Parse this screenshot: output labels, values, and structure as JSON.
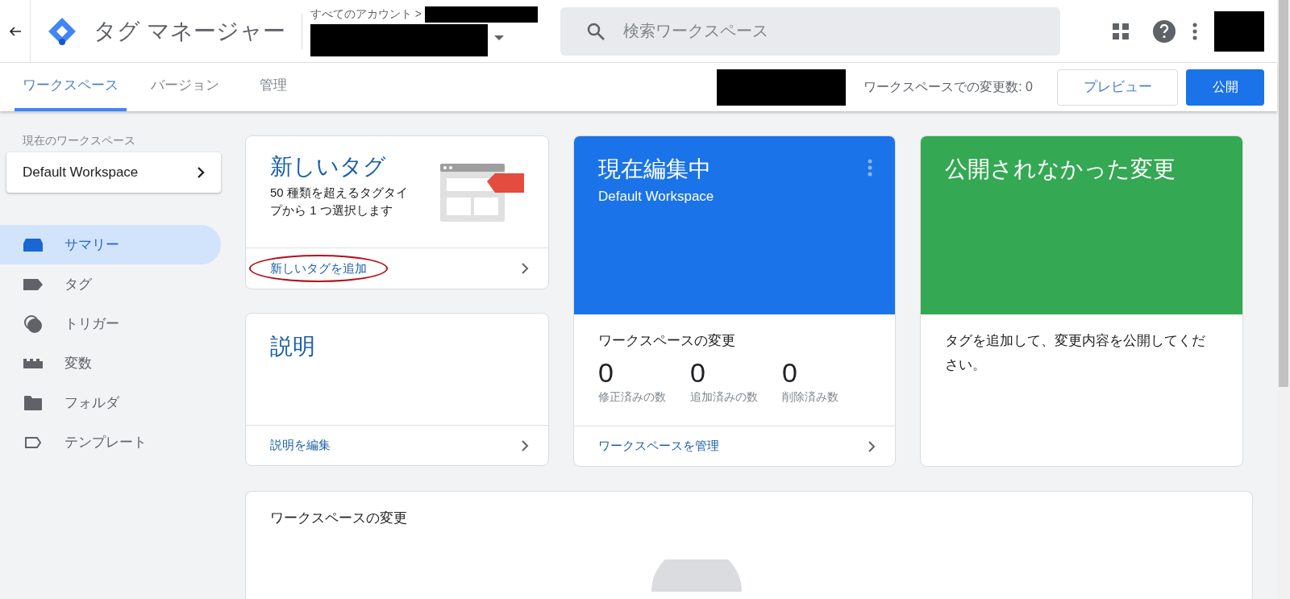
{
  "header": {
    "app_title": "タグ マネージャー",
    "breadcrumb": "すべてのアカウント >",
    "search": {
      "placeholder": "検索ワークスペース"
    }
  },
  "tabs": [
    {
      "label": "ワークスペース",
      "selected": true
    },
    {
      "label": "バージョン",
      "selected": false
    },
    {
      "label": "管理",
      "selected": false
    }
  ],
  "toolbar": {
    "changes_count": "ワークスペースでの変更数: 0",
    "preview_button": "プレビュー",
    "publish_button": "公開"
  },
  "sidebar": {
    "section_label": "現在のワークスペース",
    "workspace": "Default Workspace",
    "items": [
      {
        "label": "サマリー",
        "kind": "summary",
        "selected": true
      },
      {
        "label": "タグ",
        "kind": "tag",
        "selected": false
      },
      {
        "label": "トリガー",
        "kind": "trigger",
        "selected": false
      },
      {
        "label": "変数",
        "kind": "variable",
        "selected": false
      },
      {
        "label": "フォルダ",
        "kind": "folder",
        "selected": false
      },
      {
        "label": "テンプレート",
        "kind": "template",
        "selected": false
      }
    ]
  },
  "new_tag_card": {
    "title": "新しいタグ",
    "description": "50 種類を超えるタグタイプから 1 つ選択します",
    "link": "新しいタグを追加",
    "link_circled": true
  },
  "description_card": {
    "title": "説明",
    "link": "説明を編集"
  },
  "editing_card": {
    "title": "現在編集中",
    "workspace": "Default Workspace",
    "changes_label": "ワークスペースの変更",
    "stats": [
      {
        "value": "0",
        "label": "修正済みの数"
      },
      {
        "value": "0",
        "label": "追加済みの数"
      },
      {
        "value": "0",
        "label": "削除済み数"
      }
    ],
    "link": "ワークスペースを管理"
  },
  "unpublished_card": {
    "title": "公開されなかった変更",
    "message": "タグを追加して、変更内容を公開してください。"
  },
  "changes_panel": {
    "title": "ワークスペースの変更"
  }
}
